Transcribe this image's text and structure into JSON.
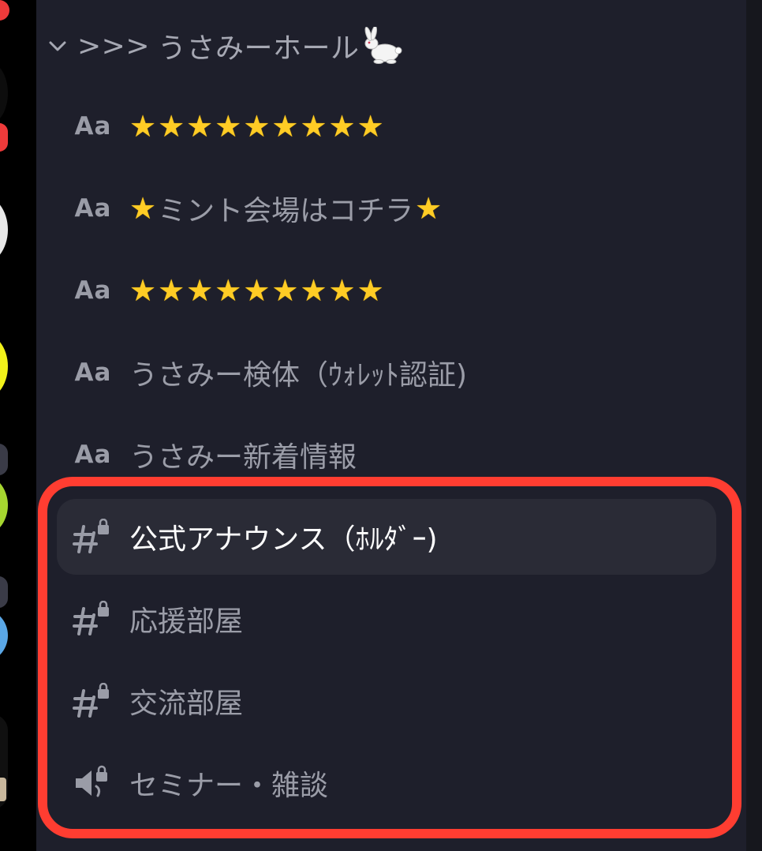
{
  "colors": {
    "highlight": "#ff3d31",
    "panel_bg": "#1e1f2b",
    "active_row_bg": "#2a2b36",
    "muted_text": "#9b9da8",
    "star": "#ffcc25"
  },
  "category": {
    "name": "うさみーホール",
    "prefix": ">>>",
    "icon": "rabbit-emoji",
    "collapse_icon": "chevron-down-icon"
  },
  "channels": [
    {
      "type": "text-forum",
      "icon_label": "Aa",
      "stars": 9,
      "name": ""
    },
    {
      "type": "text-forum",
      "icon_label": "Aa",
      "name": "ミント会場はコチラ",
      "star_left": true,
      "star_right": true
    },
    {
      "type": "text-forum",
      "icon_label": "Aa",
      "stars": 9,
      "name": ""
    },
    {
      "type": "text-forum",
      "icon_label": "Aa",
      "name": "うさみー検体（ｳｫﾚｯﾄ認証)"
    },
    {
      "type": "text-forum",
      "icon_label": "Aa",
      "name": "うさみー新着情報"
    },
    {
      "type": "locked-text",
      "icon": "locked-hash-icon",
      "name": "公式アナウンス（ﾎﾙﾀﾞｰ)",
      "active": true
    },
    {
      "type": "locked-text",
      "icon": "locked-hash-icon",
      "name": "応援部屋"
    },
    {
      "type": "locked-text",
      "icon": "locked-hash-icon",
      "name": "交流部屋"
    },
    {
      "type": "locked-voice",
      "icon": "locked-speaker-icon",
      "name": "セミナー・雑談"
    }
  ]
}
